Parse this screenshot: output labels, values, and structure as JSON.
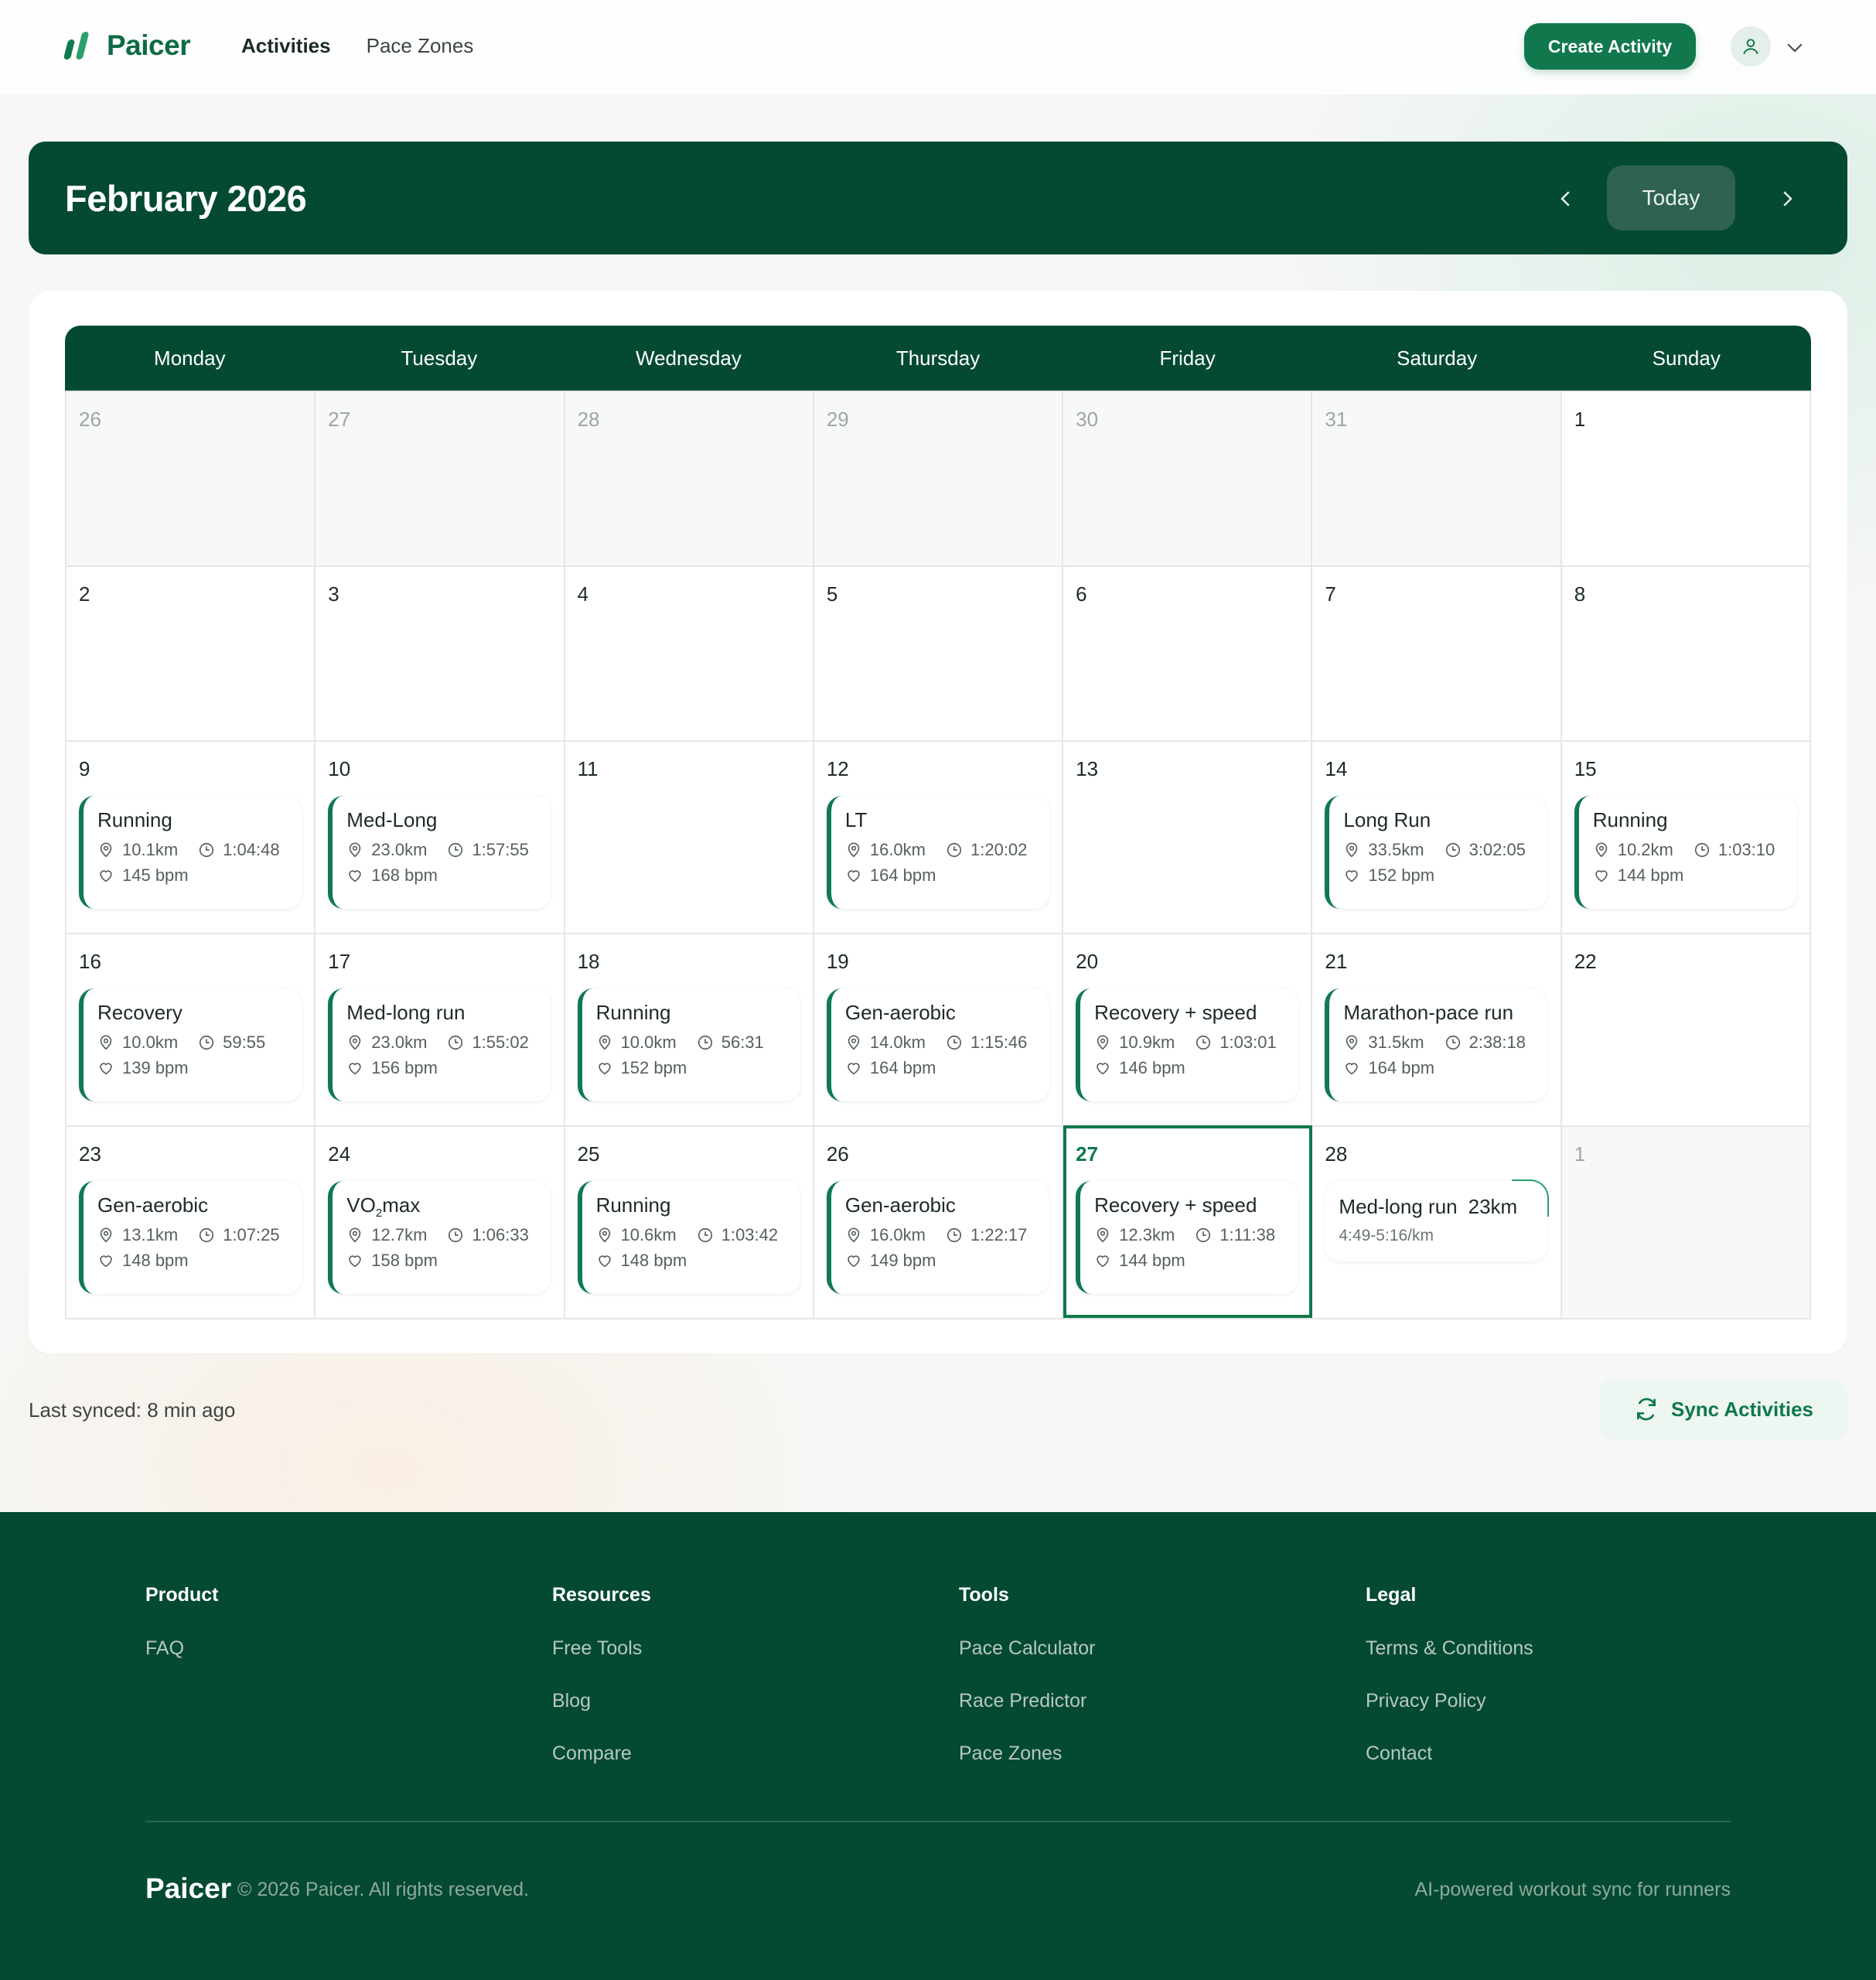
{
  "brand": {
    "name": "Paicer",
    "accent": "#10784c",
    "dark": "#044a32"
  },
  "nav": {
    "items": [
      {
        "label": "Activities"
      },
      {
        "label": "Pace Zones"
      }
    ]
  },
  "header": {
    "create_label": "Create Activity"
  },
  "calendar": {
    "month_title": "February 2026",
    "today_label": "Today",
    "weekdays": [
      "Monday",
      "Tuesday",
      "Wednesday",
      "Thursday",
      "Friday",
      "Saturday",
      "Sunday"
    ],
    "cells": [
      {
        "day": "26",
        "muted": true
      },
      {
        "day": "27",
        "muted": true
      },
      {
        "day": "28",
        "muted": true
      },
      {
        "day": "29",
        "muted": true
      },
      {
        "day": "30",
        "muted": true
      },
      {
        "day": "31",
        "muted": true
      },
      {
        "day": "1"
      },
      {
        "day": "2"
      },
      {
        "day": "3"
      },
      {
        "day": "4"
      },
      {
        "day": "5"
      },
      {
        "day": "6"
      },
      {
        "day": "7"
      },
      {
        "day": "8"
      },
      {
        "day": "9",
        "activity": {
          "title": "Running",
          "distance": "10.1km",
          "time": "1:04:48",
          "hr": "145 bpm"
        }
      },
      {
        "day": "10",
        "activity": {
          "title": "Med-Long",
          "distance": "23.0km",
          "time": "1:57:55",
          "hr": "168 bpm"
        }
      },
      {
        "day": "11"
      },
      {
        "day": "12",
        "activity": {
          "title": "LT",
          "distance": "16.0km",
          "time": "1:20:02",
          "hr": "164 bpm"
        }
      },
      {
        "day": "13"
      },
      {
        "day": "14",
        "activity": {
          "title": "Long Run",
          "distance": "33.5km",
          "time": "3:02:05",
          "hr": "152 bpm"
        }
      },
      {
        "day": "15",
        "activity": {
          "title": "Running",
          "distance": "10.2km",
          "time": "1:03:10",
          "hr": "144 bpm"
        }
      },
      {
        "day": "16",
        "activity": {
          "title": "Recovery",
          "distance": "10.0km",
          "time": "59:55",
          "hr": "139 bpm"
        }
      },
      {
        "day": "17",
        "activity": {
          "title": "Med-long run",
          "distance": "23.0km",
          "time": "1:55:02",
          "hr": "156 bpm"
        }
      },
      {
        "day": "18",
        "activity": {
          "title": "Running",
          "distance": "10.0km",
          "time": "56:31",
          "hr": "152 bpm"
        }
      },
      {
        "day": "19",
        "activity": {
          "title": "Gen-aerobic",
          "distance": "14.0km",
          "time": "1:15:46",
          "hr": "164 bpm"
        }
      },
      {
        "day": "20",
        "activity": {
          "title": "Recovery + speed",
          "distance": "10.9km",
          "time": "1:03:01",
          "hr": "146 bpm"
        }
      },
      {
        "day": "21",
        "activity": {
          "title": "Marathon-pace run",
          "distance": "31.5km",
          "time": "2:38:18",
          "hr": "164 bpm"
        }
      },
      {
        "day": "22"
      },
      {
        "day": "23",
        "activity": {
          "title": "Gen-aerobic",
          "distance": "13.1km",
          "time": "1:07:25",
          "hr": "148 bpm"
        }
      },
      {
        "day": "24",
        "activity": {
          "title": "VO",
          "title_sub": "2",
          "title_rest": "max",
          "distance": "12.7km",
          "time": "1:06:33",
          "hr": "158 bpm"
        }
      },
      {
        "day": "25",
        "activity": {
          "title": "Running",
          "distance": "10.6km",
          "time": "1:03:42",
          "hr": "148 bpm"
        }
      },
      {
        "day": "26",
        "activity": {
          "title": "Gen-aerobic",
          "distance": "16.0km",
          "time": "1:22:17",
          "hr": "149 bpm"
        }
      },
      {
        "day": "27",
        "today": true,
        "activity": {
          "title": "Recovery + speed",
          "distance": "12.3km",
          "time": "1:11:38",
          "hr": "144 bpm"
        }
      },
      {
        "day": "28",
        "planned": {
          "title": "Med-long run",
          "distance": "23km",
          "pace": "4:49-5:16/km"
        }
      },
      {
        "day": "1",
        "muted": true
      }
    ]
  },
  "sync": {
    "last_synced": "Last synced: 8 min ago",
    "button_label": "Sync Activities"
  },
  "footer": {
    "columns": [
      {
        "title": "Product",
        "links": [
          "FAQ"
        ]
      },
      {
        "title": "Resources",
        "links": [
          "Free Tools",
          "Blog",
          "Compare"
        ]
      },
      {
        "title": "Tools",
        "links": [
          "Pace Calculator",
          "Race Predictor",
          "Pace Zones"
        ]
      },
      {
        "title": "Legal",
        "links": [
          "Terms & Conditions",
          "Privacy Policy",
          "Contact"
        ]
      }
    ],
    "logo": "Paicer",
    "copyright": "© 2026 Paicer. All rights reserved.",
    "tagline": "AI-powered workout sync for runners"
  }
}
